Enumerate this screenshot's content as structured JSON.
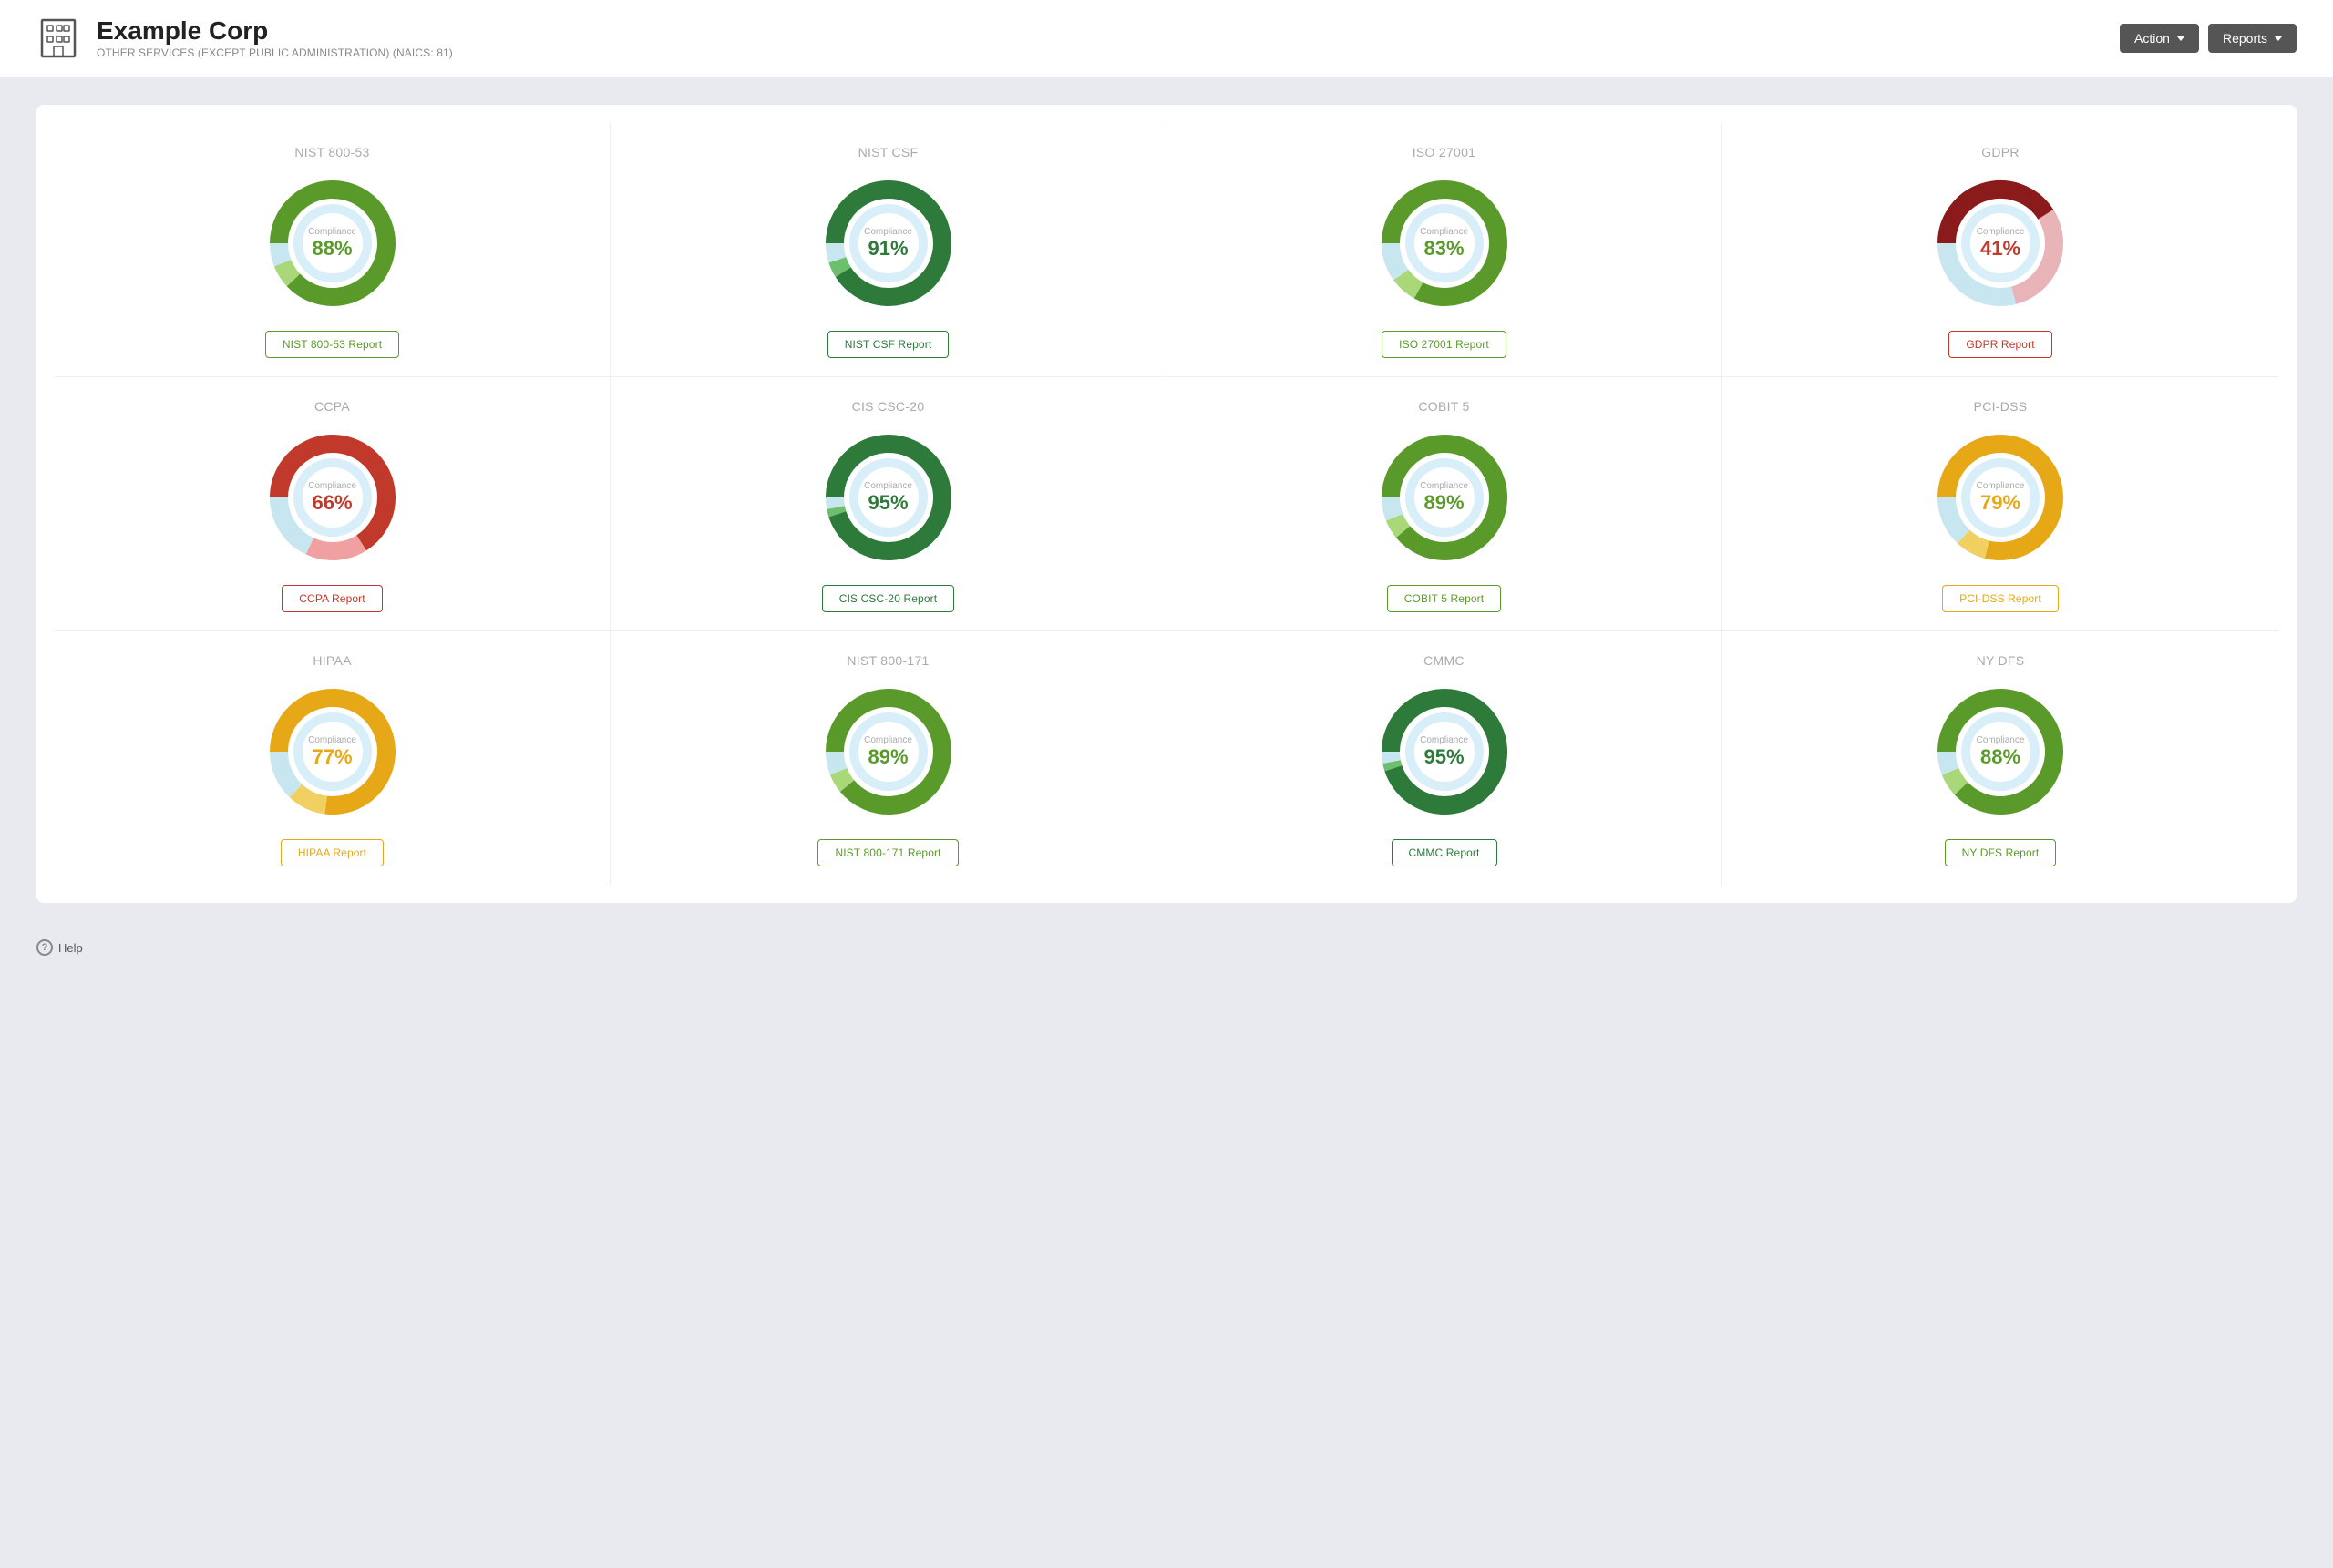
{
  "header": {
    "company_name": "Example Corp",
    "company_subtitle": "OTHER SERVICES (EXCEPT PUBLIC ADMINISTRATION) (NAICS: 81)",
    "action_button": "Action",
    "reports_button": "Reports"
  },
  "help": {
    "label": "Help"
  },
  "cards": [
    {
      "id": "nist-800-53",
      "title": "NIST 800-53",
      "compliance": 88,
      "compliance_label": "Compliance",
      "btn_label": "NIST 800-53 Report",
      "color_primary": "#5a9a2a",
      "color_secondary": "#a8d878",
      "color_track": "#c8e6f0",
      "color_text": "#5a9a2a",
      "segments": [
        {
          "value": 88,
          "color": "#5a9a2a"
        },
        {
          "value": 6,
          "color": "#a8d878"
        },
        {
          "value": 6,
          "color": "#c8e6f0"
        }
      ]
    },
    {
      "id": "nist-csf",
      "title": "NIST CSF",
      "compliance": 91,
      "compliance_label": "Compliance",
      "btn_label": "NIST CSF Report",
      "color_primary": "#2d7a3a",
      "color_secondary": "#6dbf6d",
      "color_track": "#c8e6f0",
      "color_text": "#2d7a3a",
      "segments": [
        {
          "value": 91,
          "color": "#2d7a3a"
        },
        {
          "value": 4,
          "color": "#6dbf6d"
        },
        {
          "value": 5,
          "color": "#c8e6f0"
        }
      ]
    },
    {
      "id": "iso-27001",
      "title": "ISO 27001",
      "compliance": 83,
      "compliance_label": "Compliance",
      "btn_label": "ISO 27001 Report",
      "color_primary": "#5a9a2a",
      "color_secondary": "#a8d878",
      "color_track": "#c8e6f0",
      "color_text": "#5a9a2a",
      "segments": [
        {
          "value": 83,
          "color": "#5a9a2a"
        },
        {
          "value": 7,
          "color": "#a8d878"
        },
        {
          "value": 10,
          "color": "#c8e6f0"
        }
      ]
    },
    {
      "id": "gdpr",
      "title": "GDPR",
      "compliance": 41,
      "compliance_label": "Compliance",
      "btn_label": "GDPR Report",
      "color_primary": "#8b1a1a",
      "color_secondary": "#e8b4b8",
      "color_track": "#c8e6f0",
      "color_text": "#c0392b",
      "segments": [
        {
          "value": 41,
          "color": "#8b1a1a"
        },
        {
          "value": 30,
          "color": "#e8b4b8"
        },
        {
          "value": 29,
          "color": "#c8e6f0"
        }
      ]
    },
    {
      "id": "ccpa",
      "title": "CCPA",
      "compliance": 66,
      "compliance_label": "Compliance",
      "btn_label": "CCPA Report",
      "color_primary": "#c0392b",
      "color_secondary": "#f0a0a0",
      "color_track": "#c8e6f0",
      "color_text": "#c0392b",
      "segments": [
        {
          "value": 66,
          "color": "#c0392b"
        },
        {
          "value": 16,
          "color": "#f0a0a0"
        },
        {
          "value": 18,
          "color": "#c8e6f0"
        }
      ]
    },
    {
      "id": "cis-csc-20",
      "title": "CIS CSC-20",
      "compliance": 95,
      "compliance_label": "Compliance",
      "btn_label": "CIS CSC-20 Report",
      "color_primary": "#2d7a3a",
      "color_secondary": "#6dbf6d",
      "color_track": "#c8e6f0",
      "color_text": "#2d7a3a",
      "segments": [
        {
          "value": 95,
          "color": "#2d7a3a"
        },
        {
          "value": 2,
          "color": "#6dbf6d"
        },
        {
          "value": 3,
          "color": "#c8e6f0"
        }
      ]
    },
    {
      "id": "cobit-5",
      "title": "COBIT 5",
      "compliance": 89,
      "compliance_label": "Compliance",
      "btn_label": "COBIT 5 Report",
      "color_primary": "#5a9a2a",
      "color_secondary": "#a8d878",
      "color_track": "#c8e6f0",
      "color_text": "#5a9a2a",
      "segments": [
        {
          "value": 89,
          "color": "#5a9a2a"
        },
        {
          "value": 5,
          "color": "#a8d878"
        },
        {
          "value": 6,
          "color": "#c8e6f0"
        }
      ]
    },
    {
      "id": "pci-dss",
      "title": "PCI-DSS",
      "compliance": 79,
      "compliance_label": "Compliance",
      "btn_label": "PCI-DSS Report",
      "color_primary": "#e6a817",
      "color_secondary": "#f0d060",
      "color_track": "#c8e6f0",
      "color_text": "#e6a817",
      "segments": [
        {
          "value": 79,
          "color": "#e6a817"
        },
        {
          "value": 8,
          "color": "#f0d060"
        },
        {
          "value": 13,
          "color": "#c8e6f0"
        }
      ]
    },
    {
      "id": "hipaa",
      "title": "HIPAA",
      "compliance": 77,
      "compliance_label": "Compliance",
      "btn_label": "HIPAA Report",
      "color_primary": "#e6a817",
      "color_secondary": "#f0d060",
      "color_track": "#c8e6f0",
      "color_text": "#e6a817",
      "segments": [
        {
          "value": 77,
          "color": "#e6a817"
        },
        {
          "value": 10,
          "color": "#f0d060"
        },
        {
          "value": 13,
          "color": "#c8e6f0"
        }
      ]
    },
    {
      "id": "nist-800-171",
      "title": "NIST 800-171",
      "compliance": 89,
      "compliance_label": "Compliance",
      "btn_label": "NIST 800-171 Report",
      "color_primary": "#5a9a2a",
      "color_secondary": "#a8d878",
      "color_track": "#c8e6f0",
      "color_text": "#5a9a2a",
      "segments": [
        {
          "value": 89,
          "color": "#5a9a2a"
        },
        {
          "value": 5,
          "color": "#a8d878"
        },
        {
          "value": 6,
          "color": "#c8e6f0"
        }
      ]
    },
    {
      "id": "cmmc",
      "title": "CMMC",
      "compliance": 95,
      "compliance_label": "Compliance",
      "btn_label": "CMMC Report",
      "color_primary": "#2d7a3a",
      "color_secondary": "#6dbf6d",
      "color_track": "#c8e6f0",
      "color_text": "#2d7a3a",
      "segments": [
        {
          "value": 95,
          "color": "#2d7a3a"
        },
        {
          "value": 2,
          "color": "#6dbf6d"
        },
        {
          "value": 3,
          "color": "#c8e6f0"
        }
      ]
    },
    {
      "id": "ny-dfs",
      "title": "NY DFS",
      "compliance": 88,
      "compliance_label": "Compliance",
      "btn_label": "NY DFS Report",
      "color_primary": "#5a9a2a",
      "color_secondary": "#a8d878",
      "color_track": "#c8e6f0",
      "color_text": "#5a9a2a",
      "segments": [
        {
          "value": 88,
          "color": "#5a9a2a"
        },
        {
          "value": 6,
          "color": "#a8d878"
        },
        {
          "value": 6,
          "color": "#c8e6f0"
        }
      ]
    }
  ]
}
